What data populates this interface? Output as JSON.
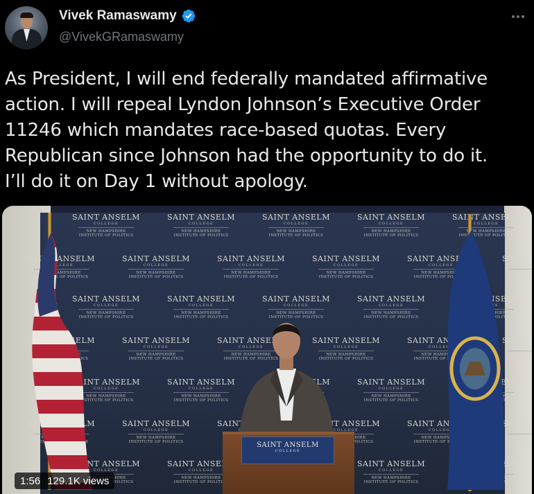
{
  "author": {
    "display_name": "Vivek Ramaswamy",
    "handle": "@VivekGRamaswamy",
    "verified": true,
    "avatar_icon": "profile-avatar"
  },
  "menu_icon": "more-options-icon",
  "tweet": {
    "text": "As President, I will end federally mandated affirmative\naction. I will repeal Lyndon Johnson’s Executive Order\n11246 which mandates race-based quotas. Every\nRepublican since Johnson had the opportunity to do it.\nI’ll do it on Day 1 without apology."
  },
  "video": {
    "duration": "1:56",
    "views": "129.1K views",
    "backdrop_logo": {
      "line1": "SAINT ANSELM",
      "line2": "COLLEGE",
      "line3": "NEW HAMPSHIRE",
      "line4": "INSTITUTE OF POLITICS"
    },
    "podium_sign": {
      "line1": "SAINT ANSELM",
      "line2": "COLLEGE"
    }
  },
  "colors": {
    "background": "#000000",
    "text": "#e7e9ea",
    "secondary": "#71767b",
    "verified": "#1d9bf0"
  }
}
